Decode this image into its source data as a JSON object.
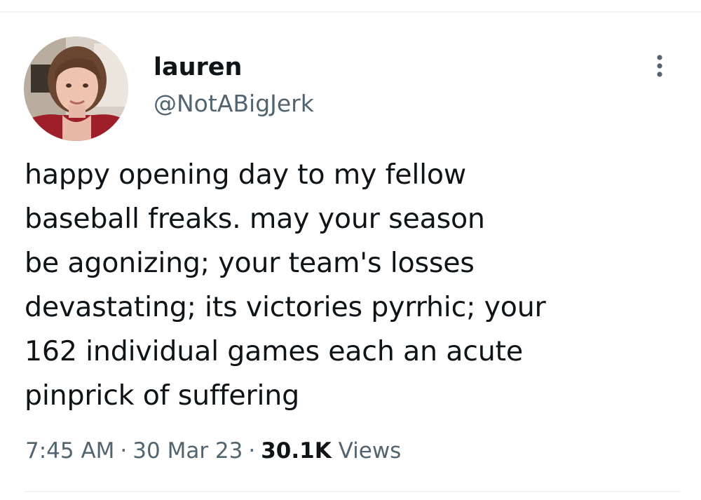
{
  "tweet": {
    "author": {
      "display_name": "lauren",
      "handle": "@NotABigJerk",
      "avatar_icon": "profile-photo"
    },
    "more_icon": "vertical-ellipsis-icon",
    "text_lines": [
      "happy opening day to my fellow",
      "baseball freaks. may your season",
      "be agonizing; your team's losses",
      "devastating; its victories pyrrhic; your",
      "162 individual games each an acute",
      "pinprick of suffering"
    ],
    "meta": {
      "time": "7:45 AM",
      "separator": "·",
      "date": "30 Mar 23",
      "views_count": "30.1K",
      "views_label": "Views"
    }
  },
  "colors": {
    "text_primary": "#0f1419",
    "text_secondary": "#536471",
    "divider": "#eff3f4"
  }
}
